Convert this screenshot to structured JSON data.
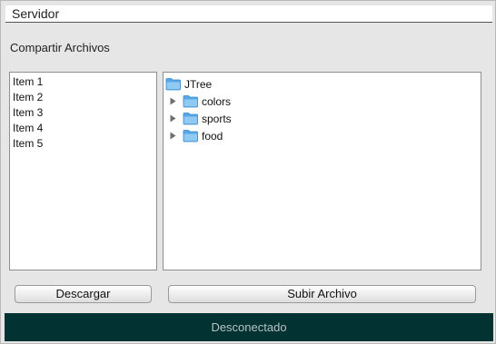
{
  "header": {
    "title": "Servidor"
  },
  "section": {
    "label": "Compartir Archivos"
  },
  "file_list": {
    "items": [
      "Item 1",
      "Item 2",
      "Item 3",
      "Item 4",
      "Item 5"
    ]
  },
  "tree": {
    "root": {
      "label": "JTree",
      "icon": "folder-open-icon"
    },
    "children": [
      {
        "label": "colors",
        "icon": "folder-icon",
        "expanded": false
      },
      {
        "label": "sports",
        "icon": "folder-icon",
        "expanded": false
      },
      {
        "label": "food",
        "icon": "folder-icon",
        "expanded": false
      }
    ]
  },
  "buttons": {
    "download_label": "Descargar",
    "upload_label": "Subir Archivo"
  },
  "status": {
    "text": "Desconectado",
    "background_color": "#033232"
  }
}
